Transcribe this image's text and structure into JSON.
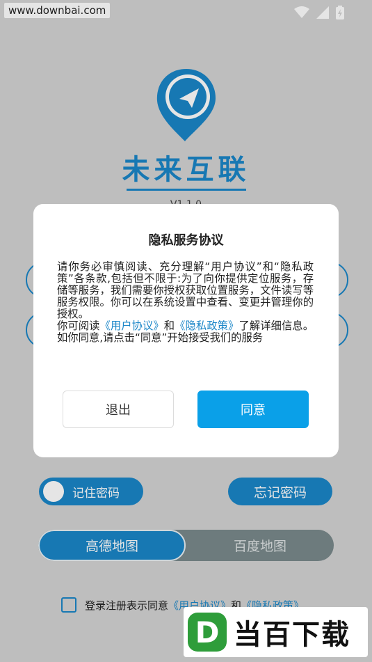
{
  "watermark_top": "www.downbai.com",
  "app": {
    "name": "未来互联",
    "version": "V1.1.0"
  },
  "remember": {
    "label": "记住密码"
  },
  "forgot": {
    "label": "忘记密码"
  },
  "map": {
    "option_a": "高德地图",
    "option_b": "百度地图",
    "selected": "高德地图"
  },
  "agreement": {
    "prefix": "登录注册表示同意",
    "user_link": "《用户协议》",
    "and": "和",
    "privacy_link": "《隐私政策》"
  },
  "brand_watermark": {
    "logo_letter": "D",
    "text": "当百下载"
  },
  "dialog": {
    "title": "隐私服务协议",
    "para1": "请你务必审慎阅读、充分理解“用户协议”和“隐私政策”各条款,包括但不限于:为了向你提供定位服务，存储等服务，我们需要你授权获取位置服务，文件读写等服务权限。你可以在系统设置中查看、变更并管理你的授权。",
    "para2_prefix": "你可阅读",
    "para2_user_link": "《用户协议》",
    "para2_and": "和",
    "para2_privacy_link": "《隐私政策》",
    "para2_suffix": "了解详细信息。如你同意,请点击“同意”开始接受我们的服务",
    "exit_label": "退出",
    "agree_label": "同意"
  },
  "colors": {
    "brand": "#1a86c8",
    "agree_button": "#0aa0e8",
    "background": "#d4d4d4"
  }
}
